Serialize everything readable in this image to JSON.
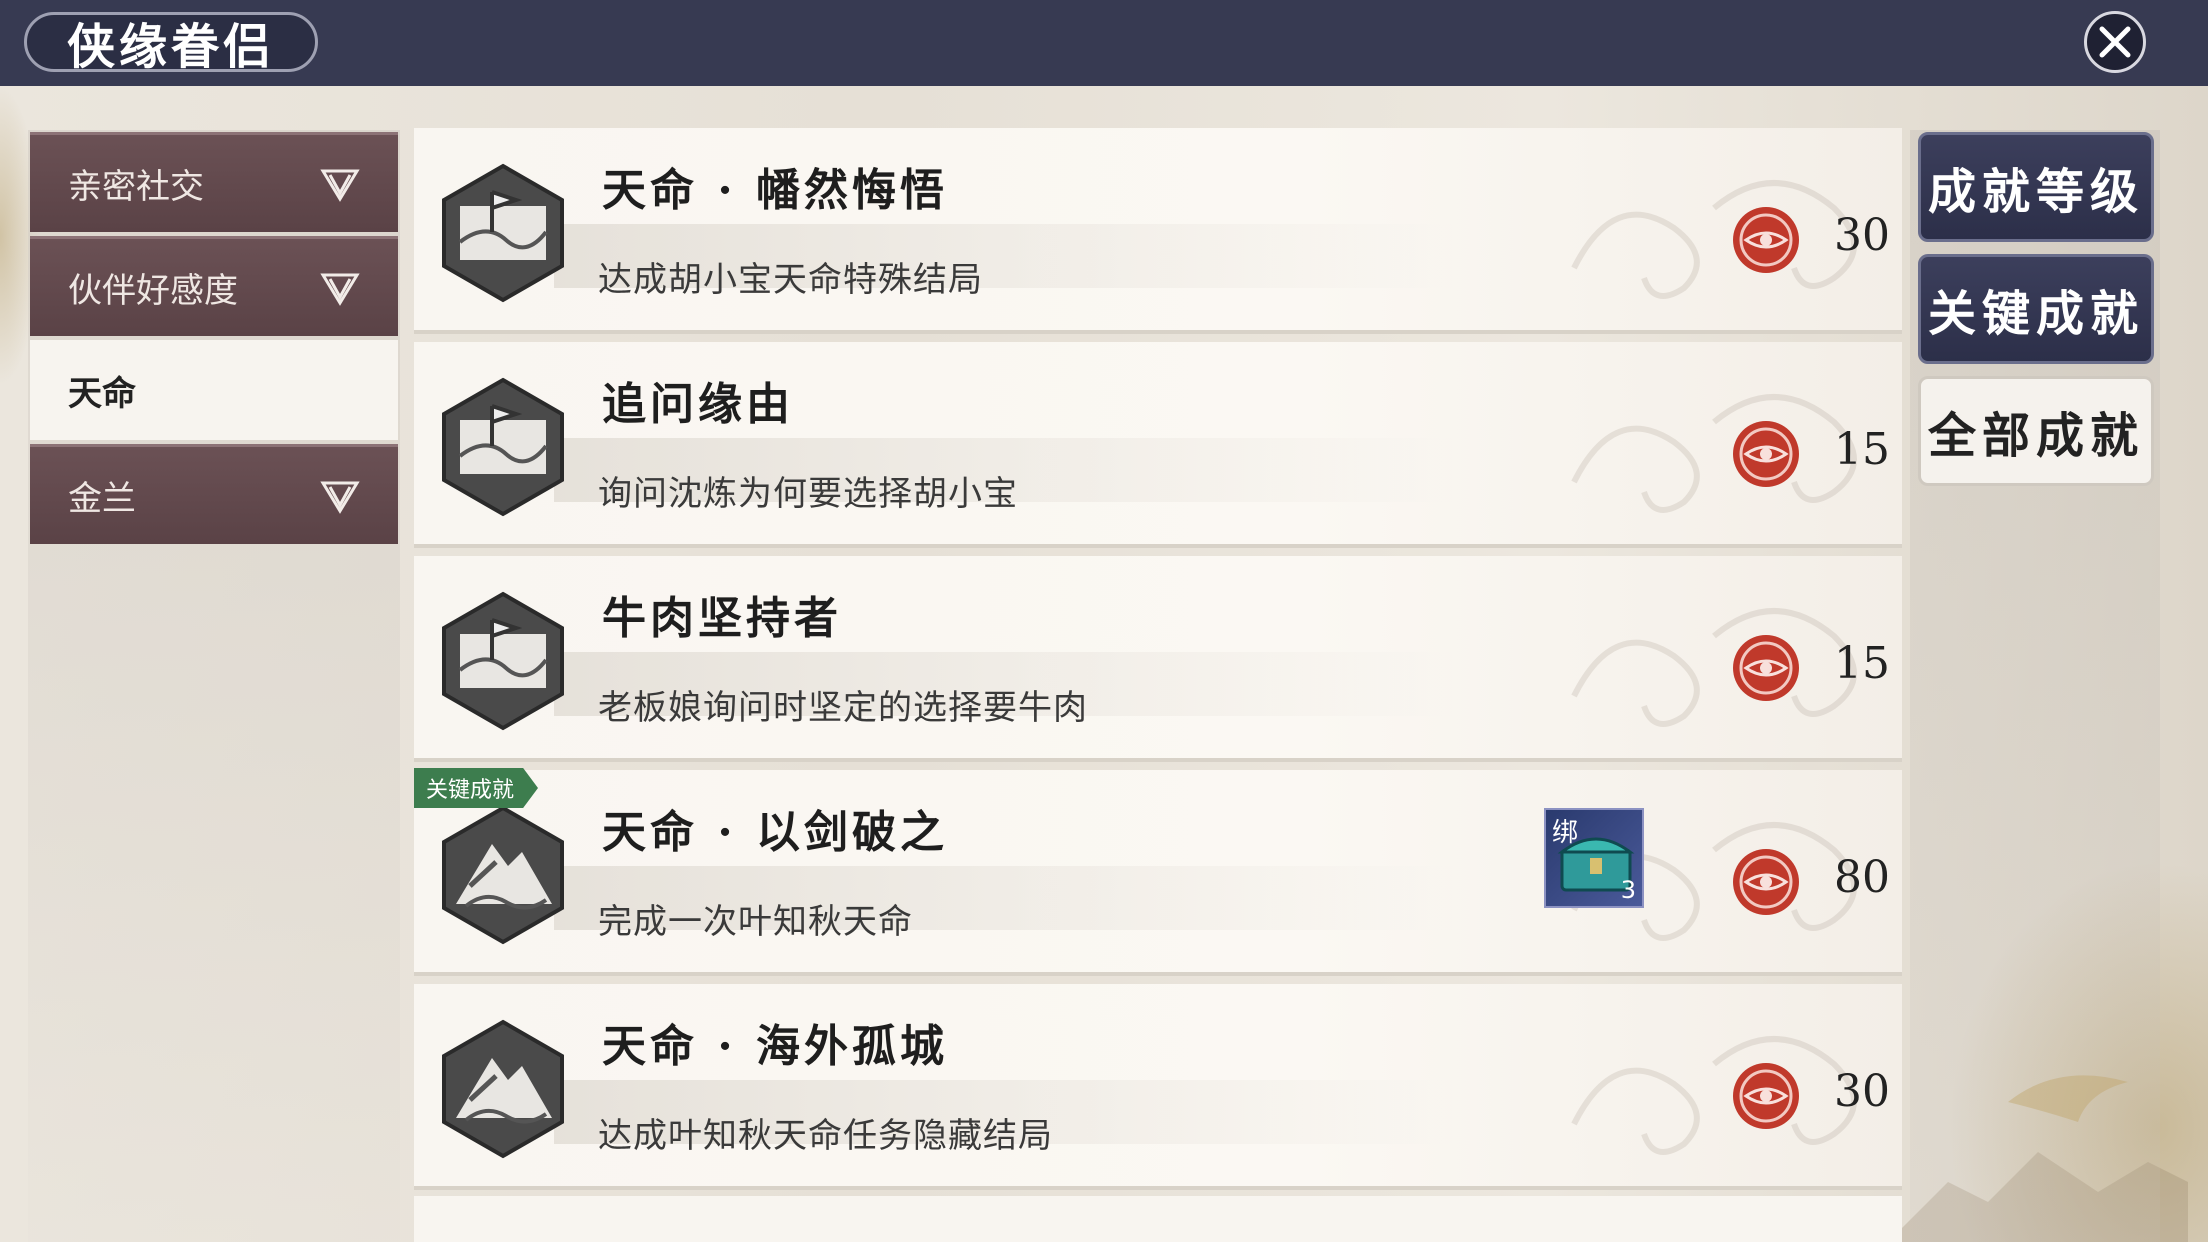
{
  "header": {
    "title": "侠缘眷侣"
  },
  "sidebar": {
    "items": [
      {
        "label": "亲密社交",
        "expandable": true,
        "active": false
      },
      {
        "label": "伙伴好感度",
        "expandable": true,
        "active": false
      },
      {
        "label": "天命",
        "expandable": false,
        "active": true
      },
      {
        "label": "金兰",
        "expandable": true,
        "active": false
      }
    ]
  },
  "achievements": [
    {
      "name": "天命 · 幡然悔悟",
      "desc": "达成胡小宝天命特殊结局",
      "points": "30",
      "icon": "flag-map-icon"
    },
    {
      "name": "追问缘由",
      "desc": "询问沈炼为何要选择胡小宝",
      "points": "15",
      "icon": "flag-map-icon"
    },
    {
      "name": "牛肉坚持者",
      "desc": "老板娘询问时坚定的选择要牛肉",
      "points": "15",
      "icon": "flag-map-icon"
    },
    {
      "name": "天命 · 以剑破之",
      "desc": "完成一次叶知秋天命",
      "points": "80",
      "icon": "mountain-icon",
      "key_tag": "关键成就",
      "reward": {
        "bind": "绑",
        "count": "3",
        "icon": "treasure-chest-icon"
      }
    },
    {
      "name": "天命 · 海外孤城",
      "desc": "达成叶知秋天命任务隐藏结局",
      "points": "30",
      "icon": "mountain-icon"
    }
  ],
  "right_tabs": [
    {
      "label": "成就等级",
      "active": false
    },
    {
      "label": "关键成就",
      "active": false
    },
    {
      "label": "全部成就",
      "active": true
    }
  ],
  "colors": {
    "topbar": "#373a52",
    "sidebar_item": "#5e4649",
    "key_tag": "#3d7d4e",
    "coin": "#c0392b"
  }
}
